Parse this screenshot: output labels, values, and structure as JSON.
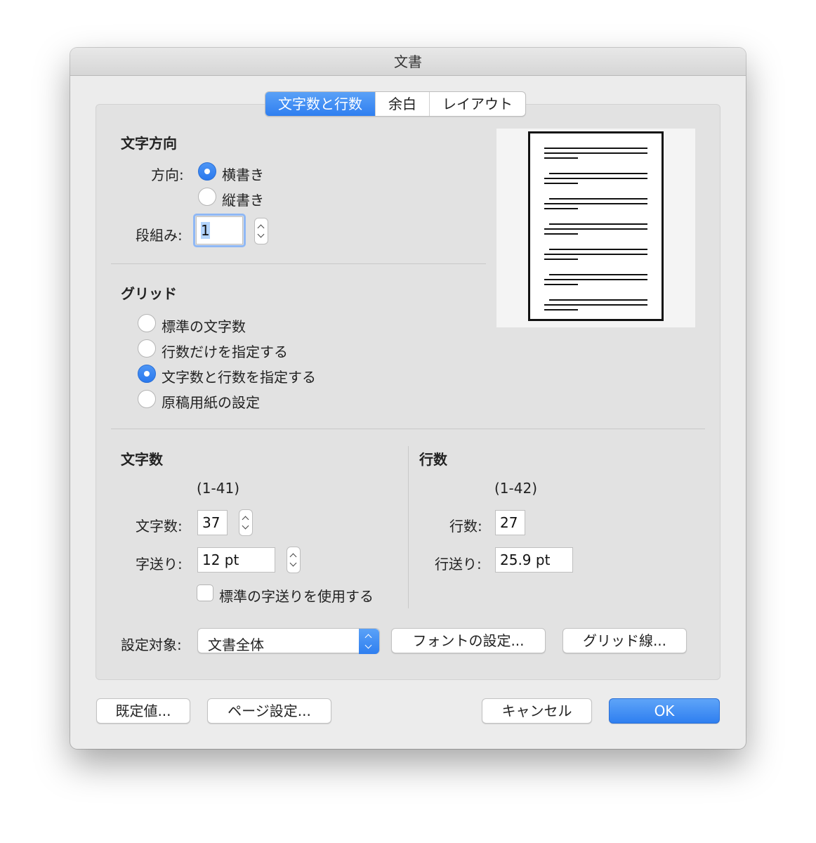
{
  "window": {
    "title": "文書"
  },
  "tabs": [
    {
      "label": "文字数と行数",
      "active": true
    },
    {
      "label": "余白",
      "active": false
    },
    {
      "label": "レイアウト",
      "active": false
    }
  ],
  "text_direction": {
    "heading": "文字方向",
    "direction_label": "方向:",
    "options": [
      {
        "label": "横書き",
        "selected": true
      },
      {
        "label": "縦書き",
        "selected": false
      }
    ],
    "columns_label": "段組み:",
    "columns_value": "1"
  },
  "grid": {
    "heading": "グリッド",
    "options": [
      {
        "label": "標準の文字数",
        "selected": false
      },
      {
        "label": "行数だけを指定する",
        "selected": false
      },
      {
        "label": "文字数と行数を指定する",
        "selected": true
      },
      {
        "label": "原稿用紙の設定",
        "selected": false
      }
    ]
  },
  "chars": {
    "heading": "文字数",
    "range": "(1-41)",
    "count_label": "文字数:",
    "count_value": "37",
    "pitch_label": "字送り:",
    "pitch_value": "12 pt",
    "default_pitch_checkbox": "標準の字送りを使用する",
    "default_pitch_checked": false
  },
  "lines": {
    "heading": "行数",
    "range": "(1-42)",
    "count_label": "行数:",
    "count_value": "27",
    "pitch_label": "行送り:",
    "pitch_value": "25.9 pt"
  },
  "apply_to": {
    "label": "設定対象:",
    "value": "文書全体"
  },
  "buttons": {
    "font_settings": "フォントの設定...",
    "grid_lines": "グリッド線...",
    "defaults": "既定値...",
    "page_setup": "ページ設定...",
    "cancel": "キャンセル",
    "ok": "OK"
  },
  "icons": {
    "stepper": "stepper-updown-icon",
    "select": "select-updown-icon"
  }
}
